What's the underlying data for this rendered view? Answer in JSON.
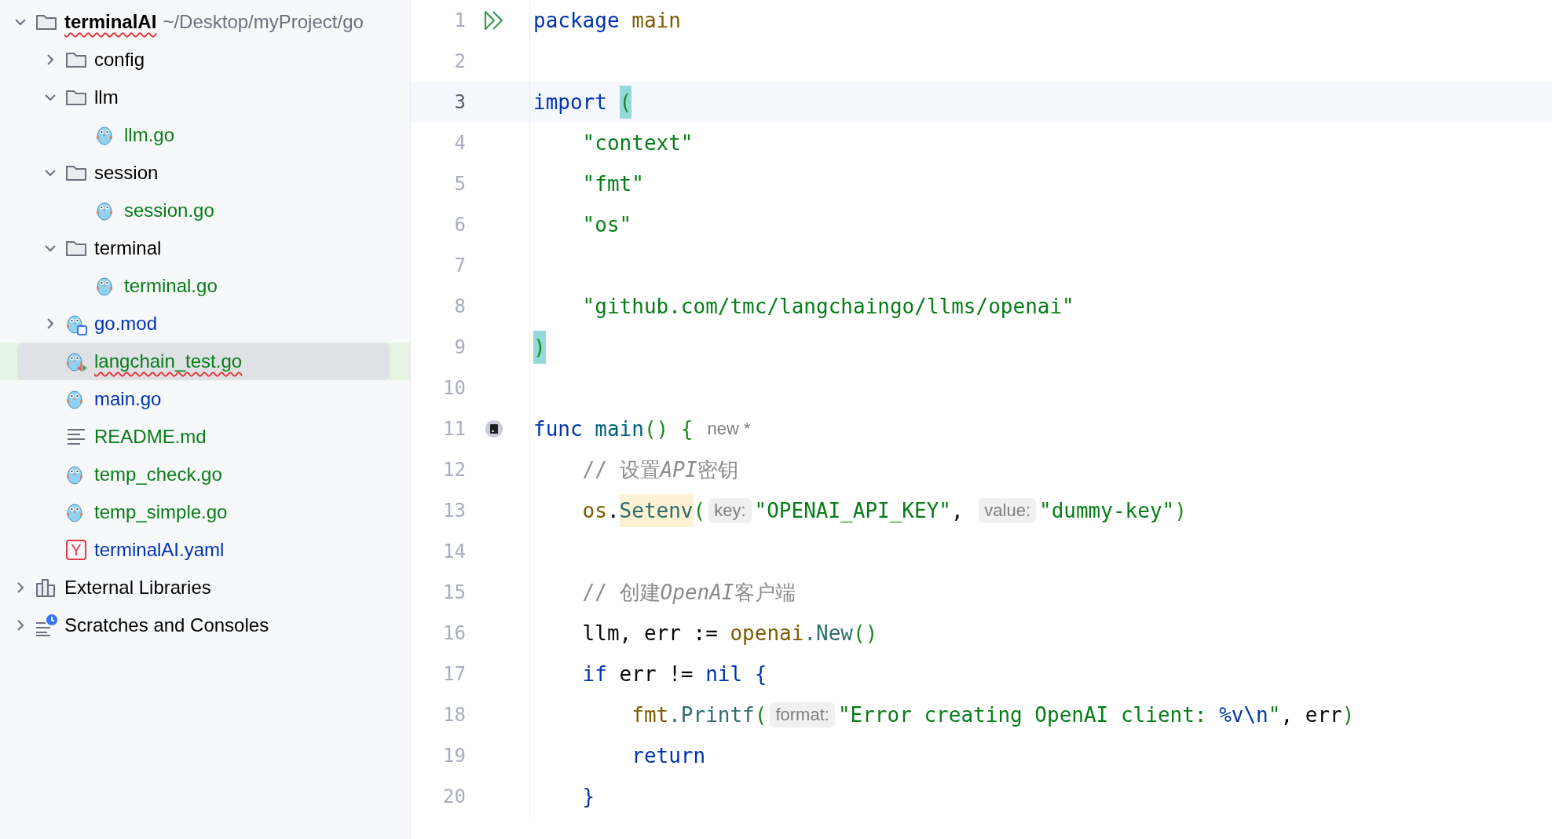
{
  "project_tree": {
    "items": [
      {
        "name": "terminalAI",
        "path": "~/Desktop/myProject/go",
        "kind": "folder",
        "color": "#000000",
        "bold": true,
        "has_errors": true,
        "selected": false,
        "expanded": true,
        "children": [
          {
            "name": "config",
            "kind": "folder",
            "color": "#000000",
            "has_errors": false,
            "selected": false,
            "expanded": false
          },
          {
            "name": "llm",
            "kind": "folder",
            "color": "#000000",
            "has_errors": false,
            "selected": false,
            "expanded": true,
            "children": [
              {
                "name": "llm.go",
                "kind": "go",
                "color": "#067d17",
                "has_errors": false,
                "selected": false
              }
            ]
          },
          {
            "name": "session",
            "kind": "folder",
            "color": "#000000",
            "has_errors": false,
            "selected": false,
            "expanded": true,
            "children": [
              {
                "name": "session.go",
                "kind": "go",
                "color": "#067d17",
                "has_errors": false,
                "selected": false
              }
            ]
          },
          {
            "name": "terminal",
            "kind": "folder",
            "color": "#000000",
            "has_errors": false,
            "selected": false,
            "expanded": true,
            "children": [
              {
                "name": "terminal.go",
                "kind": "go",
                "color": "#067d17",
                "has_errors": false,
                "selected": false
              }
            ]
          },
          {
            "name": "go.mod",
            "kind": "gomod",
            "color": "#0033b3",
            "has_errors": false,
            "selected": false,
            "expanded": false
          },
          {
            "name": "langchain_test.go",
            "kind": "gotest",
            "color": "#067d17",
            "has_errors": true,
            "selected": true
          },
          {
            "name": "main.go",
            "kind": "go",
            "color": "#0033b3",
            "has_errors": false,
            "selected": false
          },
          {
            "name": "README.md",
            "kind": "text",
            "color": "#067d17",
            "has_errors": false,
            "selected": false
          },
          {
            "name": "temp_check.go",
            "kind": "go",
            "color": "#067d17",
            "has_errors": false,
            "selected": false
          },
          {
            "name": "temp_simple.go",
            "kind": "go",
            "color": "#067d17",
            "has_errors": false,
            "selected": false
          },
          {
            "name": "terminalAI.yaml",
            "kind": "yaml",
            "icon_letter": "Y",
            "color": "#0033b3",
            "has_errors": false,
            "selected": false
          }
        ]
      },
      {
        "name": "External Libraries",
        "kind": "libraries",
        "color": "#000000",
        "has_errors": false,
        "selected": false,
        "expanded": false
      },
      {
        "name": "Scratches and Consoles",
        "kind": "scratches",
        "color": "#000000",
        "has_errors": false,
        "selected": false,
        "expanded": false
      }
    ]
  },
  "editor": {
    "lines": [
      {
        "number": "1",
        "current": false,
        "kind": "run",
        "tokens": [
          {
            "kind": "keyword",
            "text": "package"
          },
          {
            "kind": "package",
            "text": " main"
          }
        ]
      },
      {
        "number": "2",
        "current": false
      },
      {
        "number": "3",
        "current": true,
        "tokens": [
          {
            "kind": "keyword",
            "text": "import "
          },
          {
            "kind": "paren_match",
            "text": "("
          }
        ]
      },
      {
        "number": "4",
        "current": false,
        "tokens": [
          {
            "kind": "string",
            "text": "    \"context\""
          }
        ]
      },
      {
        "number": "5",
        "current": false,
        "tokens": [
          {
            "kind": "string",
            "text": "    \"fmt\""
          }
        ]
      },
      {
        "number": "6",
        "current": false,
        "tokens": [
          {
            "kind": "string",
            "text": "    \"os\""
          }
        ]
      },
      {
        "number": "7",
        "current": false
      },
      {
        "number": "8",
        "current": false,
        "tokens": [
          {
            "kind": "string",
            "text": "    \"github.com/tmc/langchaingo/llms/openai\""
          }
        ]
      },
      {
        "number": "9",
        "current": false,
        "tokens": [
          {
            "kind": "paren_match",
            "text": ")"
          }
        ]
      },
      {
        "number": "10",
        "current": false
      },
      {
        "number": "11",
        "current": false,
        "kind": "marker",
        "tokens": [
          {
            "kind": "keyword",
            "text": "func"
          },
          {
            "kind": "function",
            "text": " main"
          },
          {
            "kind": "paren",
            "text": "() {"
          },
          {
            "kind": "inlay",
            "text": "new *"
          }
        ]
      },
      {
        "number": "12",
        "current": false,
        "tokens": [
          {
            "kind": "comment",
            "text": "    // 设置"
          },
          {
            "kind": "comment_italic",
            "text": "API"
          },
          {
            "kind": "comment",
            "text": "密钥"
          }
        ]
      },
      {
        "number": "13",
        "current": false,
        "tokens": [
          {
            "kind": "package",
            "text": "    os"
          },
          {
            "kind": "plain",
            "text": "."
          },
          {
            "kind": "call_usage",
            "text": "Setenv"
          },
          {
            "kind": "paren",
            "text": "("
          },
          {
            "kind": "hint",
            "text": "key:"
          },
          {
            "kind": "string",
            "text": "\"OPENAI_API_KEY\""
          },
          {
            "kind": "plain",
            "text": ", "
          },
          {
            "kind": "hint",
            "text": "value:"
          },
          {
            "kind": "string",
            "text": "\"dummy-key\""
          },
          {
            "kind": "paren",
            "text": ")"
          }
        ]
      },
      {
        "number": "14",
        "current": false
      },
      {
        "number": "15",
        "current": false,
        "tokens": [
          {
            "kind": "comment",
            "text": "    // 创建"
          },
          {
            "kind": "comment_italic",
            "text": "OpenAI"
          },
          {
            "kind": "comment",
            "text": "客户端"
          }
        ]
      },
      {
        "number": "16",
        "current": false,
        "tokens": [
          {
            "kind": "plain",
            "text": "    llm, err := "
          },
          {
            "kind": "package",
            "text": "openai"
          },
          {
            "kind": "call",
            "text": ".New"
          },
          {
            "kind": "paren",
            "text": "()"
          }
        ]
      },
      {
        "number": "17",
        "current": false,
        "tokens": [
          {
            "kind": "keyword",
            "text": "    if"
          },
          {
            "kind": "plain",
            "text": " err != "
          },
          {
            "kind": "keyword",
            "text": "nil"
          },
          {
            "kind": "brace",
            "text": " {"
          }
        ]
      },
      {
        "number": "18",
        "current": false,
        "tokens": [
          {
            "kind": "package",
            "text": "        fmt"
          },
          {
            "kind": "call",
            "text": ".Printf"
          },
          {
            "kind": "paren",
            "text": "("
          },
          {
            "kind": "hint",
            "text": "format:"
          },
          {
            "kind": "string",
            "text": "\"Error creating OpenAI client: "
          },
          {
            "kind": "escape",
            "text": "%v\\n"
          },
          {
            "kind": "string",
            "text": "\""
          },
          {
            "kind": "plain",
            "text": ", err"
          },
          {
            "kind": "paren",
            "text": ")"
          }
        ]
      },
      {
        "number": "19",
        "current": false,
        "tokens": [
          {
            "kind": "keyword",
            "text": "        return"
          }
        ]
      },
      {
        "number": "20",
        "current": false,
        "tokens": [
          {
            "kind": "brace",
            "text": "    }"
          }
        ]
      }
    ]
  }
}
